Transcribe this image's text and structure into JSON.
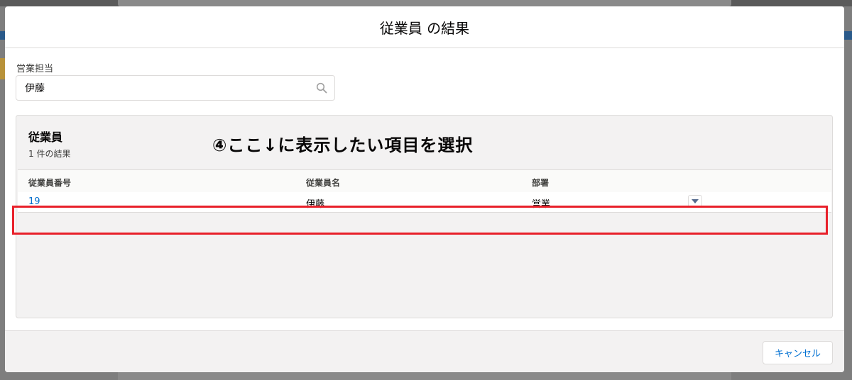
{
  "modal": {
    "title": "従業員 の結果"
  },
  "search": {
    "label": "営業担当",
    "value": "伊藤"
  },
  "results": {
    "title": "従業員",
    "count_text": "1 件の結果",
    "annotation": "④ここ↓に表示したい項目を選択",
    "columns": [
      "従業員番号",
      "従業員名",
      "部署"
    ],
    "rows": [
      {
        "number": "19",
        "name": "伊藤",
        "department": "営業"
      }
    ]
  },
  "footer": {
    "cancel_label": "キャンセル"
  },
  "colors": {
    "highlight": "#e8202a",
    "link": "#006dcc",
    "brand_button_text": "#0070d2"
  },
  "icons": {
    "search": "search-icon",
    "row_menu": "chevron-down-icon"
  }
}
